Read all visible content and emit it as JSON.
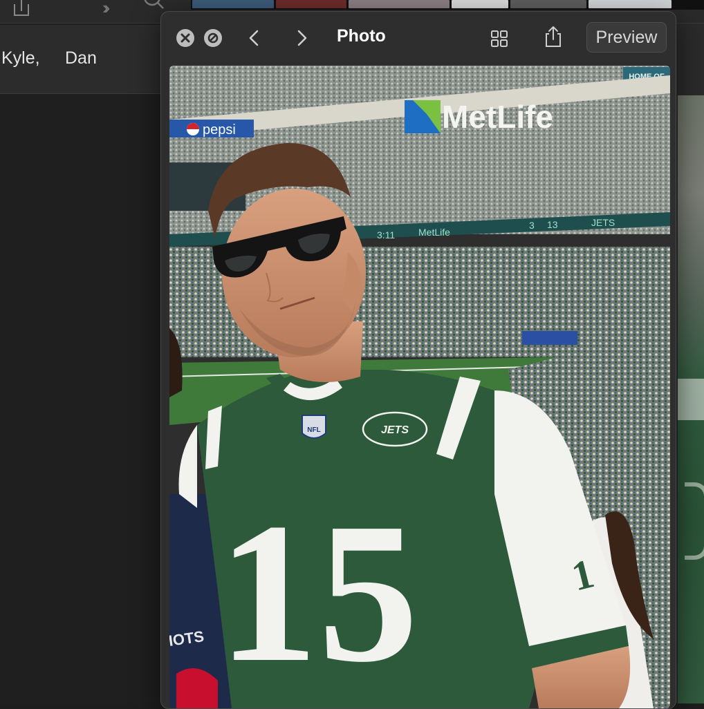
{
  "background_app": {
    "names": [
      "Kyle,",
      "Dan"
    ],
    "icons": [
      "share-icon",
      "chevron-double-right-icon",
      "search-icon"
    ]
  },
  "quicklook": {
    "title": "Photo",
    "preview_button": "Preview",
    "icons": [
      "close-circle-icon",
      "no-entry-icon",
      "chevron-left-icon",
      "chevron-right-icon",
      "grid-icon",
      "share-icon"
    ]
  },
  "photo": {
    "stadium_sponsor": "MetLife",
    "banner_left": "pepsi",
    "ribbon_clock": "3:11",
    "ribbon_sponsor": "MetLife",
    "ribbon_score": "3",
    "ribbon_score_2": "13",
    "ribbon_team": "JETS",
    "jersey_number": "15",
    "sleeve_number": "1",
    "jersey_logo": "JETS",
    "league_logo": "NFL",
    "left_shirt_text": "IOTS",
    "sign_top_right": "HOME OF",
    "colors": {
      "jersey_green": "#2d5a3a",
      "jersey_white": "#f2f2ee",
      "crowd": "#9da4a0",
      "field": "#3f7a3a",
      "sky_stands": "#8a9298"
    }
  }
}
